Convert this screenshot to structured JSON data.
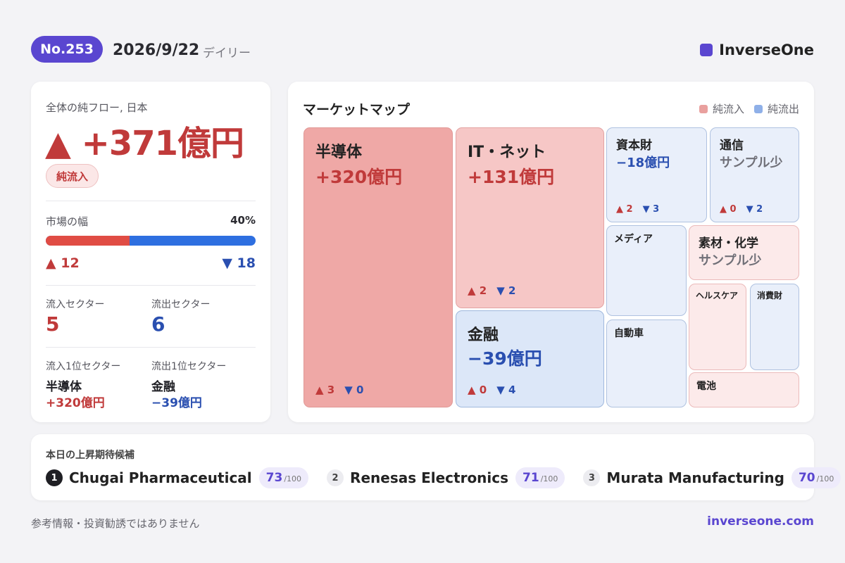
{
  "header": {
    "issue": "No.253",
    "date": "2026/9/22",
    "period": "デイリー",
    "brand": "InverseOne",
    "brand_color": "#5a46d0"
  },
  "summary": {
    "label": "全体の純フロー, 日本",
    "value": "▲ +371億円",
    "badge": "純流入",
    "breadth_label": "市場の幅",
    "breadth_pct": "40%",
    "breadth_fraction": 0.4,
    "up_count": "▲ 12",
    "down_count": "▼ 18",
    "inflow_sectors_label": "流入セクター",
    "inflow_sectors": "5",
    "outflow_sectors_label": "流出セクター",
    "outflow_sectors": "6",
    "top_inflow_label": "流入1位セクター",
    "top_inflow_name": "半導体",
    "top_inflow_value": "+320億円",
    "top_outflow_label": "流出1位セクター",
    "top_outflow_name": "金融",
    "top_outflow_value": "−39億円"
  },
  "market_map": {
    "title": "マーケットマップ",
    "legend_in": "純流入",
    "legend_out": "純流出",
    "legend_in_color": "#e9a09e",
    "legend_out_color": "#8fb0e8",
    "tiles": {
      "semi": {
        "name": "半導体",
        "value": "+320億円",
        "up": "▲ 3",
        "down": "▼ 0"
      },
      "it": {
        "name": "IT・ネット",
        "value": "+131億円",
        "up": "▲ 2",
        "down": "▼ 2"
      },
      "finance": {
        "name": "金融",
        "value": "−39億円",
        "up": "▲ 0",
        "down": "▼ 4"
      },
      "capital": {
        "name": "資本財",
        "value": "−18億円",
        "up": "▲ 2",
        "down": "▼ 3"
      },
      "telecom": {
        "name": "通信",
        "value": "サンプル少",
        "up": "▲ 0",
        "down": "▼ 2"
      },
      "media": {
        "name": "メディア"
      },
      "materials": {
        "name": "素材・化学",
        "value": "サンプル少"
      },
      "auto": {
        "name": "自動車"
      },
      "health": {
        "name": "ヘルスケア"
      },
      "consumer": {
        "name": "消費財"
      },
      "battery": {
        "name": "電池"
      }
    }
  },
  "candidates": {
    "title": "本日の上昇期待候補",
    "items": [
      {
        "rank": "1",
        "name": "Chugai Pharmaceutical",
        "score": "73",
        "denom": "/100"
      },
      {
        "rank": "2",
        "name": "Renesas Electronics",
        "score": "71",
        "denom": "/100"
      },
      {
        "rank": "3",
        "name": "Murata Manufacturing",
        "score": "70",
        "denom": "/100"
      }
    ]
  },
  "footer": {
    "disclaimer": "参考情報・投資勧誘ではありません",
    "site": "inverseone.com"
  }
}
